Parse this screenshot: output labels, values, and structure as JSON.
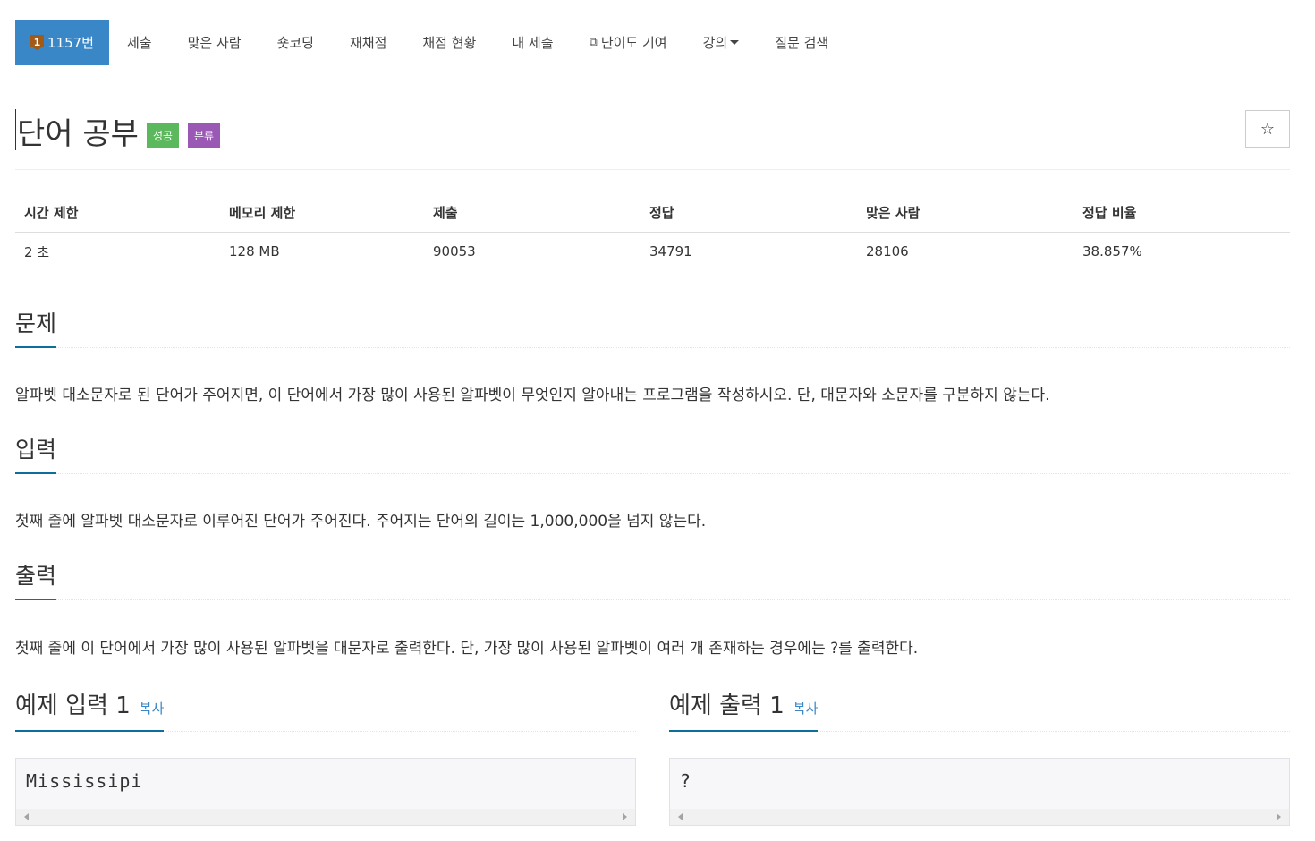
{
  "nav": {
    "problem_tier_badge": "1",
    "problem_number": "1157번",
    "items": [
      "제출",
      "맞은 사람",
      "숏코딩",
      "재채점",
      "채점 현황",
      "내 제출",
      "난이도 기여",
      "강의",
      "질문 검색"
    ]
  },
  "problem": {
    "title": "단어 공부",
    "label_success": "성공",
    "label_tags": "분류",
    "star_glyph": "☆"
  },
  "info": {
    "headers": [
      "시간 제한",
      "메모리 제한",
      "제출",
      "정답",
      "맞은 사람",
      "정답 비율"
    ],
    "values": [
      "2 초",
      "128 MB",
      "90053",
      "34791",
      "28106",
      "38.857%"
    ]
  },
  "sections": {
    "description_title": "문제",
    "description_text": "알파벳 대소문자로 된 단어가 주어지면, 이 단어에서 가장 많이 사용된 알파벳이 무엇인지 알아내는 프로그램을 작성하시오. 단, 대문자와 소문자를 구분하지 않는다.",
    "input_title": "입력",
    "input_text": "첫째 줄에 알파벳 대소문자로 이루어진 단어가 주어진다. 주어지는 단어의 길이는 1,000,000을 넘지 않는다.",
    "output_title": "출력",
    "output_text": "첫째 줄에 이 단어에서 가장 많이 사용된 알파벳을 대문자로 출력한다. 단, 가장 많이 사용된 알파벳이 여러 개 존재하는 경우에는 ?를 출력한다."
  },
  "samples": {
    "input_title": "예제 입력 1",
    "output_title": "예제 출력 1",
    "copy_label": "복사",
    "input_value": "Mississipi",
    "output_value": "?"
  },
  "colors": {
    "nav_active": "#3a87c8",
    "success": "#5cb85c",
    "tags": "#9b59b6",
    "section_underline": "#0c6e9a",
    "tier_badge": "#a25a18"
  }
}
